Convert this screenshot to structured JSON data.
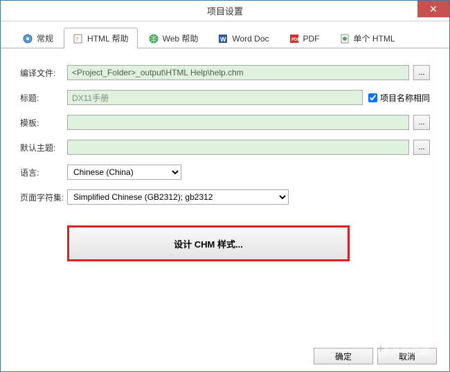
{
  "window": {
    "title": "项目设置"
  },
  "tabs": [
    {
      "label": "常规",
      "icon": "general"
    },
    {
      "label": "HTML 帮助",
      "icon": "chm"
    },
    {
      "label": "Web 帮助",
      "icon": "web"
    },
    {
      "label": "Word Doc",
      "icon": "word"
    },
    {
      "label": "PDF",
      "icon": "pdf"
    },
    {
      "label": "单个 HTML",
      "icon": "single"
    }
  ],
  "form": {
    "compile_file_label": "编译文件:",
    "compile_file_value": "<Project_Folder>_output\\HTML Help\\help.chm",
    "title_label": "标题:",
    "title_value": "DX11手册",
    "same_as_project_label": "项目名称相同",
    "same_as_project_checked": true,
    "template_label": "模板:",
    "template_value": "",
    "default_topic_label": "默认主题:",
    "default_topic_value": "",
    "language_label": "语言:",
    "language_value": "Chinese (China)",
    "charset_label": "页面字符集:",
    "charset_value": "Simplified Chinese (GB2312); gb2312",
    "design_button_label": "设计 CHM 样式...",
    "browse_label": "..."
  },
  "footer": {
    "ok": "确定",
    "cancel": "取消"
  },
  "watermark": "系统之家"
}
